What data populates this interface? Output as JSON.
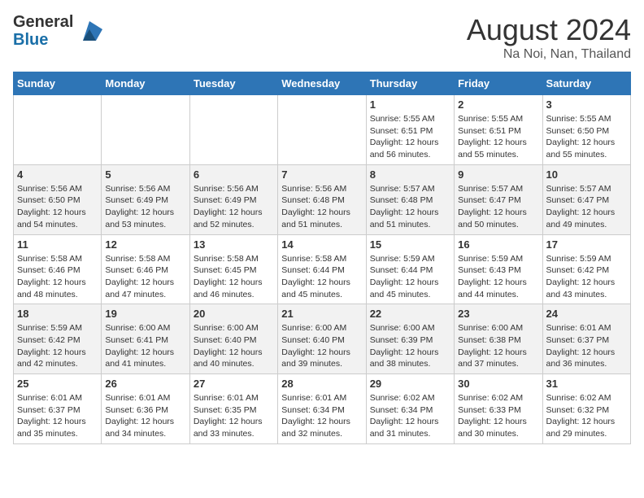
{
  "header": {
    "logo_general": "General",
    "logo_blue": "Blue",
    "month_title": "August 2024",
    "location": "Na Noi, Nan, Thailand"
  },
  "weekdays": [
    "Sunday",
    "Monday",
    "Tuesday",
    "Wednesday",
    "Thursday",
    "Friday",
    "Saturday"
  ],
  "weeks": [
    [
      {
        "day": "",
        "detail": ""
      },
      {
        "day": "",
        "detail": ""
      },
      {
        "day": "",
        "detail": ""
      },
      {
        "day": "",
        "detail": ""
      },
      {
        "day": "1",
        "detail": "Sunrise: 5:55 AM\nSunset: 6:51 PM\nDaylight: 12 hours\nand 56 minutes."
      },
      {
        "day": "2",
        "detail": "Sunrise: 5:55 AM\nSunset: 6:51 PM\nDaylight: 12 hours\nand 55 minutes."
      },
      {
        "day": "3",
        "detail": "Sunrise: 5:55 AM\nSunset: 6:50 PM\nDaylight: 12 hours\nand 55 minutes."
      }
    ],
    [
      {
        "day": "4",
        "detail": "Sunrise: 5:56 AM\nSunset: 6:50 PM\nDaylight: 12 hours\nand 54 minutes."
      },
      {
        "day": "5",
        "detail": "Sunrise: 5:56 AM\nSunset: 6:49 PM\nDaylight: 12 hours\nand 53 minutes."
      },
      {
        "day": "6",
        "detail": "Sunrise: 5:56 AM\nSunset: 6:49 PM\nDaylight: 12 hours\nand 52 minutes."
      },
      {
        "day": "7",
        "detail": "Sunrise: 5:56 AM\nSunset: 6:48 PM\nDaylight: 12 hours\nand 51 minutes."
      },
      {
        "day": "8",
        "detail": "Sunrise: 5:57 AM\nSunset: 6:48 PM\nDaylight: 12 hours\nand 51 minutes."
      },
      {
        "day": "9",
        "detail": "Sunrise: 5:57 AM\nSunset: 6:47 PM\nDaylight: 12 hours\nand 50 minutes."
      },
      {
        "day": "10",
        "detail": "Sunrise: 5:57 AM\nSunset: 6:47 PM\nDaylight: 12 hours\nand 49 minutes."
      }
    ],
    [
      {
        "day": "11",
        "detail": "Sunrise: 5:58 AM\nSunset: 6:46 PM\nDaylight: 12 hours\nand 48 minutes."
      },
      {
        "day": "12",
        "detail": "Sunrise: 5:58 AM\nSunset: 6:46 PM\nDaylight: 12 hours\nand 47 minutes."
      },
      {
        "day": "13",
        "detail": "Sunrise: 5:58 AM\nSunset: 6:45 PM\nDaylight: 12 hours\nand 46 minutes."
      },
      {
        "day": "14",
        "detail": "Sunrise: 5:58 AM\nSunset: 6:44 PM\nDaylight: 12 hours\nand 45 minutes."
      },
      {
        "day": "15",
        "detail": "Sunrise: 5:59 AM\nSunset: 6:44 PM\nDaylight: 12 hours\nand 45 minutes."
      },
      {
        "day": "16",
        "detail": "Sunrise: 5:59 AM\nSunset: 6:43 PM\nDaylight: 12 hours\nand 44 minutes."
      },
      {
        "day": "17",
        "detail": "Sunrise: 5:59 AM\nSunset: 6:42 PM\nDaylight: 12 hours\nand 43 minutes."
      }
    ],
    [
      {
        "day": "18",
        "detail": "Sunrise: 5:59 AM\nSunset: 6:42 PM\nDaylight: 12 hours\nand 42 minutes."
      },
      {
        "day": "19",
        "detail": "Sunrise: 6:00 AM\nSunset: 6:41 PM\nDaylight: 12 hours\nand 41 minutes."
      },
      {
        "day": "20",
        "detail": "Sunrise: 6:00 AM\nSunset: 6:40 PM\nDaylight: 12 hours\nand 40 minutes."
      },
      {
        "day": "21",
        "detail": "Sunrise: 6:00 AM\nSunset: 6:40 PM\nDaylight: 12 hours\nand 39 minutes."
      },
      {
        "day": "22",
        "detail": "Sunrise: 6:00 AM\nSunset: 6:39 PM\nDaylight: 12 hours\nand 38 minutes."
      },
      {
        "day": "23",
        "detail": "Sunrise: 6:00 AM\nSunset: 6:38 PM\nDaylight: 12 hours\nand 37 minutes."
      },
      {
        "day": "24",
        "detail": "Sunrise: 6:01 AM\nSunset: 6:37 PM\nDaylight: 12 hours\nand 36 minutes."
      }
    ],
    [
      {
        "day": "25",
        "detail": "Sunrise: 6:01 AM\nSunset: 6:37 PM\nDaylight: 12 hours\nand 35 minutes."
      },
      {
        "day": "26",
        "detail": "Sunrise: 6:01 AM\nSunset: 6:36 PM\nDaylight: 12 hours\nand 34 minutes."
      },
      {
        "day": "27",
        "detail": "Sunrise: 6:01 AM\nSunset: 6:35 PM\nDaylight: 12 hours\nand 33 minutes."
      },
      {
        "day": "28",
        "detail": "Sunrise: 6:01 AM\nSunset: 6:34 PM\nDaylight: 12 hours\nand 32 minutes."
      },
      {
        "day": "29",
        "detail": "Sunrise: 6:02 AM\nSunset: 6:34 PM\nDaylight: 12 hours\nand 31 minutes."
      },
      {
        "day": "30",
        "detail": "Sunrise: 6:02 AM\nSunset: 6:33 PM\nDaylight: 12 hours\nand 30 minutes."
      },
      {
        "day": "31",
        "detail": "Sunrise: 6:02 AM\nSunset: 6:32 PM\nDaylight: 12 hours\nand 29 minutes."
      }
    ]
  ]
}
